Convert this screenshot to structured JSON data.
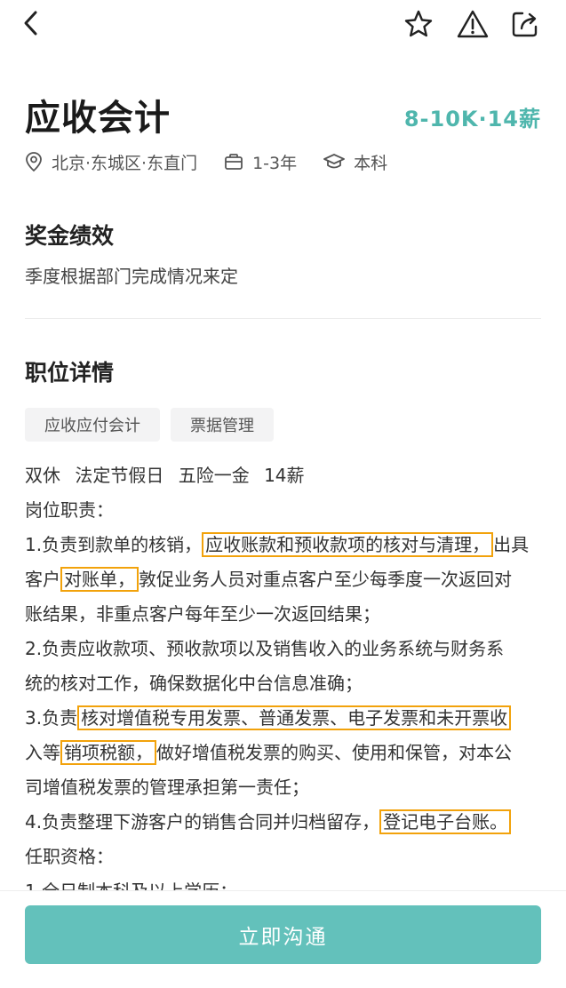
{
  "header": {
    "back_icon": "chevron-left-icon",
    "actions": [
      "star-icon",
      "warning-icon",
      "share-icon"
    ]
  },
  "job": {
    "title": "应收会计",
    "salary": "8-10K·14薪",
    "location": "北京·东城区·东直门",
    "experience": "1-3年",
    "education": "本科"
  },
  "bonus": {
    "title": "奖金绩效",
    "text": "季度根据部门完成情况来定"
  },
  "detail": {
    "title": "职位详情",
    "tags": [
      "应收应付会计",
      "票据管理"
    ],
    "line1": "双休 法定节假日 五险一金 14薪",
    "line2": "岗位职责：",
    "line3_a": "1.负责到款单的核销，",
    "line3_hl": "应收账款和预收款项的核对与清理，",
    "line3_b": "出具",
    "line4_a": "客户",
    "line4_hl": "对账单，",
    "line4_b": "敦促业务人员对重点客户至少每季度一次返回对",
    "line5": "账结果，非重点客户每年至少一次返回结果；",
    "line6": "2.负责应收款项、预收款项以及销售收入的业务系统与财务系",
    "line7": "统的核对工作，确保数据化中台信息准确；",
    "line8_a": "3.负责",
    "line8_hl": "核对增值税专用发票、普通发票、电子发票和未开票收",
    "line9_a": "入等",
    "line9_hl": "销项税额，",
    "line9_b": "做好增值税发票的购买、使用和保管，对本公",
    "line10": "司增值税发票的管理承担第一责任；",
    "line11_a": "4.负责整理下游客户的销售合同并归档留存，",
    "line11_hl": "登记电子台账。",
    "line12": "任职资格：",
    "line13": "1.全日制本科及以上学历；"
  },
  "footer": {
    "cta_label": "立即沟通"
  },
  "colors": {
    "accent": "#4fb6ad",
    "button": "#63c1bb",
    "highlight": "#f2a20b"
  }
}
